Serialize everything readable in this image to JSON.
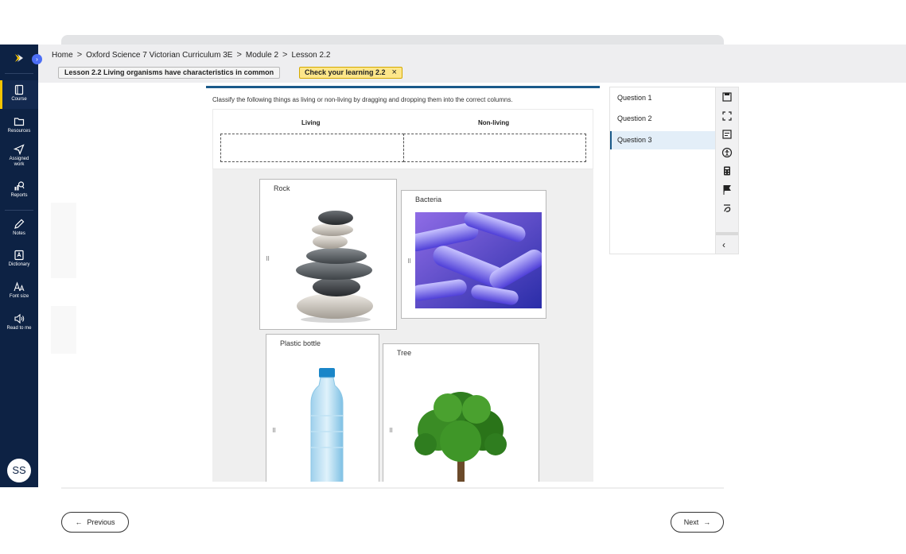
{
  "breadcrumb": [
    {
      "label": "Home"
    },
    {
      "label": "Oxford Science 7 Victorian Curriculum 3E"
    },
    {
      "label": "Module 2"
    },
    {
      "label": "Lesson 2.2"
    }
  ],
  "breadcrumb_separator": ">",
  "header": {
    "lesson_chip": "Lesson 2.2 Living organisms have characteristics in common",
    "check_chip": "Check your learning 2.2",
    "check_chip_close": "×"
  },
  "sidebar": {
    "items": [
      {
        "label": "Course",
        "icon": "book-icon",
        "active": true
      },
      {
        "label": "Resources",
        "icon": "folder-icon"
      },
      {
        "label": "Assigned work",
        "label_line1": "Assigned",
        "label_line2": "work",
        "icon": "send-icon"
      },
      {
        "label": "Reports",
        "icon": "reports-icon"
      },
      {
        "label": "Notes",
        "icon": "pencil-icon"
      },
      {
        "label": "Dictionary",
        "icon": "dictionary-icon"
      },
      {
        "label": "Font size",
        "icon": "font-size-icon"
      },
      {
        "label": "Read to me",
        "icon": "speaker-icon"
      }
    ],
    "avatar_initials": "SS"
  },
  "question": {
    "instruction": "Classify the following things as living or non-living by dragging and dropping them into the correct columns.",
    "columns": [
      "Living",
      "Non-living"
    ],
    "items": [
      {
        "label": "Rock",
        "image": "stacked-stones"
      },
      {
        "label": "Bacteria",
        "image": "bacteria-micrograph"
      },
      {
        "label": "Plastic bottle",
        "image": "water-bottle"
      },
      {
        "label": "Tree",
        "image": "green-tree"
      }
    ],
    "drag_handle_glyph": "⠿"
  },
  "question_nav": {
    "items": [
      "Question 1",
      "Question 2",
      "Question 3"
    ],
    "active_index": 2
  },
  "tools": [
    "save-icon",
    "fullscreen-icon",
    "notes-icon",
    "accessibility-icon",
    "calculator-icon",
    "flag-icon",
    "translate-icon"
  ],
  "collapse_glyph": "‹",
  "footer": {
    "previous_label": "Previous",
    "next_label": "Next",
    "previous_arrow": "←",
    "next_arrow": "→"
  },
  "colors": {
    "sidebar_bg": "#0d2244",
    "accent_yellow": "#f5c400",
    "check_chip_bg": "#fde68a",
    "active_question_bg": "#e3eef8"
  }
}
